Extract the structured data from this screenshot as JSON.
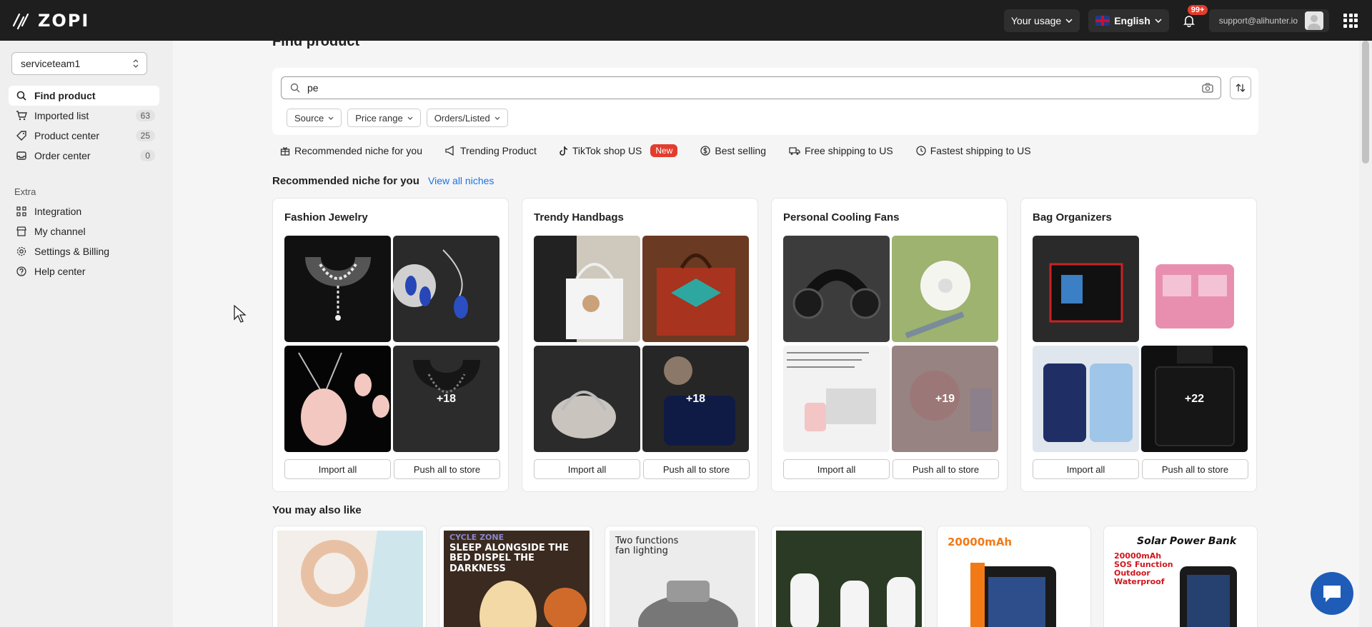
{
  "app": {
    "logo_text": "ZOPI"
  },
  "topbar": {
    "usage_label": "Your usage",
    "language_label": "English",
    "notification_count": "99+",
    "account_email": "support@alihunter.io"
  },
  "sidebar": {
    "team": "serviceteam1",
    "main_items": [
      {
        "label": "Find product",
        "count": ""
      },
      {
        "label": "Imported list",
        "count": "63"
      },
      {
        "label": "Product center",
        "count": "25"
      },
      {
        "label": "Order center",
        "count": "0"
      }
    ],
    "extra_label": "Extra",
    "extra_items": [
      {
        "label": "Integration"
      },
      {
        "label": "My channel"
      },
      {
        "label": "Settings & Billing"
      },
      {
        "label": "Help center"
      }
    ]
  },
  "main": {
    "page_title": "Find product",
    "search_value": "pe",
    "filters": [
      "Source",
      "Price range",
      "Orders/Listed"
    ],
    "tabs": [
      {
        "label": "Recommended niche for you"
      },
      {
        "label": "Trending Product"
      },
      {
        "label": "TikTok shop US",
        "badge": "New"
      },
      {
        "label": "Best selling"
      },
      {
        "label": "Free shipping to US"
      },
      {
        "label": "Fastest shipping to US"
      }
    ],
    "niche_heading": "Recommended niche for you",
    "niche_link": "View all niches",
    "niches": [
      {
        "title": "Fashion Jewelry",
        "more": "+18"
      },
      {
        "title": "Trendy Handbags",
        "more": "+18"
      },
      {
        "title": "Personal Cooling Fans",
        "more": "+19"
      },
      {
        "title": "Bag Organizers",
        "more": "+22"
      }
    ],
    "import_all_label": "Import all",
    "push_all_label": "Push all to store",
    "also_like_heading": "You may also like",
    "products": [
      {
        "caption": ""
      },
      {
        "caption": "SLEEP ALONGSIDE THE BED DISPEL THE DARKNESS",
        "brand": "CYCLE ZONE"
      },
      {
        "caption": "Two functions fan lighting"
      },
      {
        "caption": ""
      },
      {
        "caption": "20000mAh"
      },
      {
        "caption": "Solar Power Bank",
        "sub": "20000mAh SOS Function Outdoor Waterproof"
      }
    ]
  }
}
